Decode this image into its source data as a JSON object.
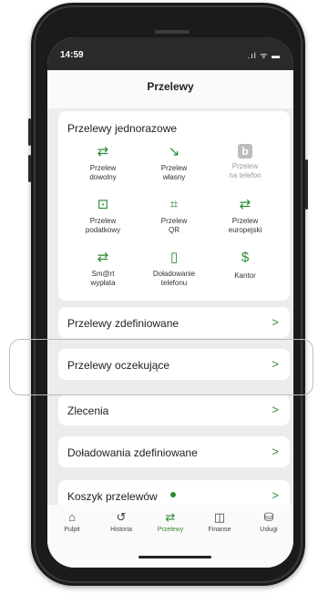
{
  "status_bar": {
    "time": "14:59",
    "icons": ".ıl ᯤ ▬"
  },
  "header": {
    "title": "Przelewy"
  },
  "one_time": {
    "title": "Przelewy jednorazowe",
    "items": [
      {
        "icon": "arrows-swap-icon",
        "glyph": "⇄",
        "label1": "Przelew",
        "label2": "dowolny",
        "muted": false
      },
      {
        "icon": "arrow-down-right-icon",
        "glyph": "↘",
        "label1": "Przelew",
        "label2": "własny",
        "muted": false
      },
      {
        "icon": "blik-icon",
        "glyph": "b",
        "label1": "Przelew",
        "label2": "na telefon",
        "muted": true
      },
      {
        "icon": "tax-document-icon",
        "glyph": "⊡",
        "label1": "Przelew",
        "label2": "podatkowy",
        "muted": false
      },
      {
        "icon": "qr-code-icon",
        "glyph": "⌗",
        "label1": "Przelew",
        "label2": "QR",
        "muted": false
      },
      {
        "icon": "arrows-swap-icon",
        "glyph": "⇄",
        "label1": "Przelew",
        "label2": "europejski",
        "muted": false
      },
      {
        "icon": "arrows-swap-icon",
        "glyph": "⇄",
        "label1": "Sm@rt",
        "label2": "wypłata",
        "muted": false
      },
      {
        "icon": "phone-topup-icon",
        "glyph": "▯",
        "label1": "Doładowanie",
        "label2": "telefonu",
        "muted": false
      },
      {
        "icon": "currency-exchange-icon",
        "glyph": "$",
        "label1": "Kantor",
        "label2": "",
        "muted": false
      }
    ]
  },
  "menu": [
    {
      "label": "Przelewy zdefiniowane",
      "chevron": ">"
    },
    {
      "label": "Przelewy oczekujące",
      "chevron": ">"
    },
    {
      "label": "Zlecenia",
      "chevron": ">"
    },
    {
      "label": "Doładowania zdefiniowane",
      "chevron": ">"
    },
    {
      "label": "Koszyk przelewów",
      "chevron": ">"
    }
  ],
  "tabbar": [
    {
      "icon": "home-icon",
      "glyph": "⌂",
      "label": "Pulpit",
      "active": false
    },
    {
      "icon": "history-icon",
      "glyph": "↺",
      "label": "Historia",
      "active": false
    },
    {
      "icon": "transfers-icon",
      "glyph": "⇄",
      "label": "Przelewy",
      "active": true
    },
    {
      "icon": "finance-icon",
      "glyph": "◫",
      "label": "Finanse",
      "active": false
    },
    {
      "icon": "services-icon",
      "glyph": "⛁",
      "label": "Usługi",
      "active": false
    }
  ],
  "colors": {
    "accent": "#2c8a34",
    "muted": "#9a9a9a"
  }
}
